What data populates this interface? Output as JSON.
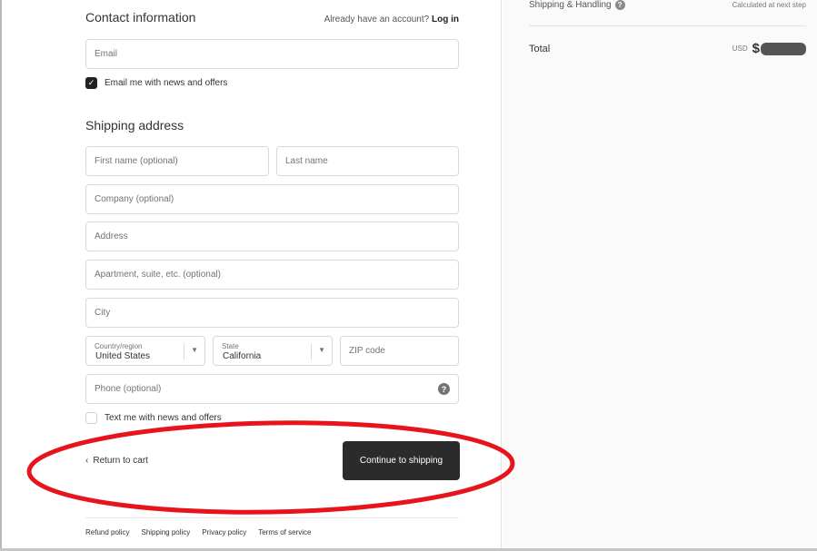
{
  "contact": {
    "title": "Contact information",
    "login_prompt": "Already have an account?",
    "login_link": "Log in",
    "email_placeholder": "Email",
    "news_label": "Email me with news and offers",
    "news_checked": true
  },
  "shipping": {
    "title": "Shipping address",
    "first_name_placeholder": "First name (optional)",
    "last_name_placeholder": "Last name",
    "company_placeholder": "Company (optional)",
    "address_placeholder": "Address",
    "apartment_placeholder": "Apartment, suite, etc. (optional)",
    "city_placeholder": "City",
    "country_label": "Country/region",
    "country_value": "United States",
    "state_label": "State",
    "state_value": "California",
    "zip_placeholder": "ZIP code",
    "phone_placeholder": "Phone (optional)",
    "text_label": "Text me with news and offers",
    "text_checked": false
  },
  "actions": {
    "return_label": "Return to cart",
    "continue_label": "Continue to shipping"
  },
  "footer": {
    "links": [
      "Refund policy",
      "Shipping policy",
      "Privacy policy",
      "Terms of service"
    ]
  },
  "summary": {
    "shipping_label": "Shipping & Handling",
    "shipping_value": "Calculated at next step",
    "total_label": "Total",
    "currency": "USD",
    "dollar_sign": "$"
  },
  "icons": {
    "checkmark": "check-icon",
    "help": "question-circle-icon",
    "caret": "chevron-down-icon",
    "back": "chevron-left-icon"
  },
  "colors": {
    "button_bg": "#2b2b2b",
    "annotation_red": "#e8141c",
    "sidebar_bg": "#fafafa"
  }
}
